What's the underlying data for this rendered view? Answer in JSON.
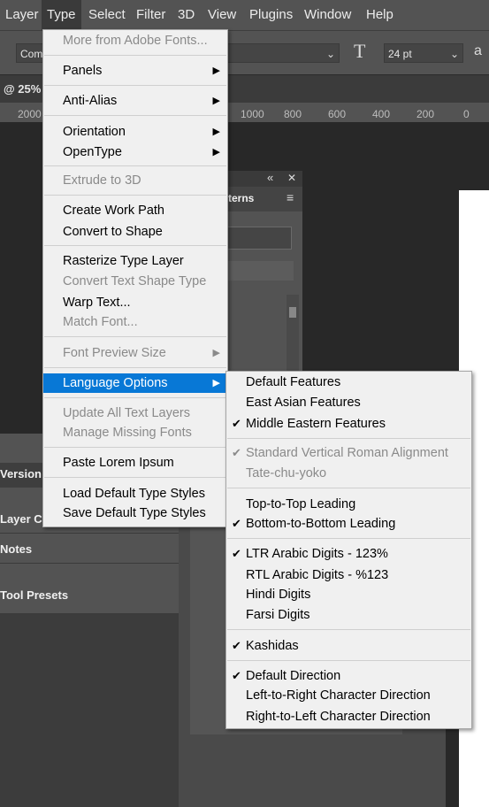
{
  "menubar": [
    "Layer",
    "Type",
    "Select",
    "Filter",
    "3D",
    "View",
    "Plugins",
    "Window",
    "Help"
  ],
  "options": {
    "font_partial": "Com",
    "size": "24 pt",
    "aa_partial": "a",
    "size_icon": "T"
  },
  "tab": {
    "zoom": "@ 25%"
  },
  "ruler": [
    "2000",
    "1000",
    "800",
    "600",
    "400",
    "200",
    "0"
  ],
  "panels": {
    "version": "Version",
    "layer_comps": "Layer Co",
    "notes": "Notes",
    "tool_presets": "Tool Presets",
    "float_tab": "terns"
  },
  "type_menu": {
    "items": [
      {
        "label": "More from Adobe Fonts...",
        "disabled": true
      },
      {
        "label": "Panels",
        "submenu": true
      },
      {
        "label": "Anti-Alias",
        "submenu": true
      },
      {
        "label": "Orientation",
        "submenu": true
      },
      {
        "label": "OpenType",
        "submenu": true
      },
      {
        "label": "Extrude to 3D",
        "disabled": true
      },
      {
        "label": "Create Work Path"
      },
      {
        "label": "Convert to Shape"
      },
      {
        "label": "Rasterize Type Layer"
      },
      {
        "label": "Convert Text Shape Type",
        "disabled": true
      },
      {
        "label": "Warp Text..."
      },
      {
        "label": "Match Font...",
        "disabled": true
      },
      {
        "label": "Font Preview Size",
        "disabled": true,
        "submenu": true
      },
      {
        "label": "Language Options",
        "submenu": true,
        "highlighted": true
      },
      {
        "label": "Update All Text Layers",
        "disabled": true
      },
      {
        "label": "Manage Missing Fonts",
        "disabled": true
      },
      {
        "label": "Paste Lorem Ipsum"
      },
      {
        "label": "Load Default Type Styles"
      },
      {
        "label": "Save Default Type Styles"
      }
    ]
  },
  "language_menu": {
    "items": [
      {
        "label": "Default Features"
      },
      {
        "label": "East Asian Features"
      },
      {
        "label": "Middle Eastern Features",
        "checked": true
      },
      {
        "label": "Standard Vertical Roman Alignment",
        "checked": true,
        "disabled": true
      },
      {
        "label": "Tate-chu-yoko",
        "disabled": true
      },
      {
        "label": "Top-to-Top Leading"
      },
      {
        "label": "Bottom-to-Bottom Leading",
        "checked": true
      },
      {
        "label": "LTR Arabic Digits - 123%",
        "checked": true
      },
      {
        "label": "RTL Arabic Digits - %123"
      },
      {
        "label": "Hindi Digits"
      },
      {
        "label": "Farsi Digits"
      },
      {
        "label": "Kashidas",
        "checked": true
      },
      {
        "label": "Default Direction",
        "checked": true
      },
      {
        "label": "Left-to-Right Character Direction"
      },
      {
        "label": "Right-to-Left Character Direction"
      }
    ]
  },
  "glyphs": {
    "arrow": "▶",
    "check": "✔",
    "chevron": "⌄",
    "collapse": "«",
    "close": "✕",
    "menu": "≡"
  },
  "colors": {
    "menu_bg": "#f0f0f0",
    "highlight": "#0878d6",
    "chrome": "#535353",
    "canvas": "#282828"
  }
}
